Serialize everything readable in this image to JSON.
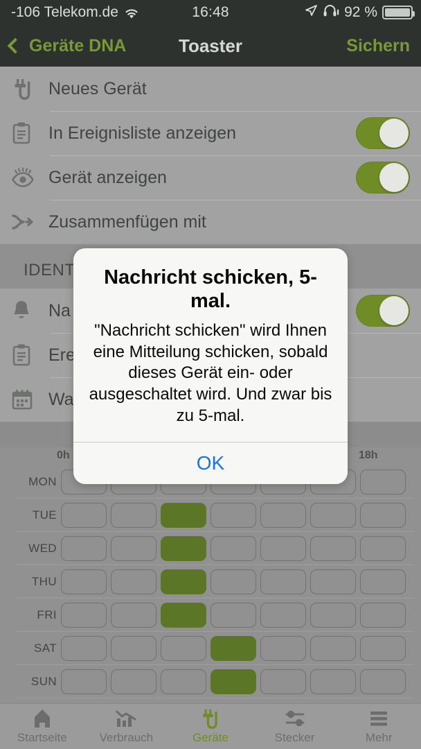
{
  "status_bar": {
    "carrier": "-106 Telekom.de",
    "wifi_icon": "wifi-icon",
    "time": "16:48",
    "location_icon": "location-arrow-icon",
    "headphones_icon": "headphones-icon",
    "battery_percent": "92 %",
    "battery_icon": "battery-icon"
  },
  "nav_bar": {
    "back_label": "Geräte DNA",
    "back_icon": "chevron-left-icon",
    "title": "Toaster",
    "save_label": "Sichern"
  },
  "settings_top": {
    "rows": [
      {
        "icon": "plug-icon",
        "label": "Neues Gerät",
        "toggle": null
      },
      {
        "icon": "clipboard-icon",
        "label": "In Ereignisliste anzeigen",
        "toggle": "on"
      },
      {
        "icon": "eye-icon",
        "label": "Gerät anzeigen",
        "toggle": "on"
      },
      {
        "icon": "merge-arrow-icon",
        "label": "Zusammenfügen mit",
        "toggle": null
      }
    ]
  },
  "section": {
    "header": "IDENTIFIKATION"
  },
  "settings_lower": {
    "rows": [
      {
        "icon": "bell-icon",
        "label": "Na",
        "toggle": "on"
      },
      {
        "icon": "clipboard-icon",
        "label": "Ere",
        "toggle": null
      },
      {
        "icon": "calendar-icon",
        "label": "Wa",
        "toggle": null
      }
    ]
  },
  "schedule": {
    "hour_labels": {
      "start": "0h",
      "end": "18h"
    },
    "days": [
      "MON",
      "TUE",
      "WED",
      "THU",
      "FRI",
      "SAT",
      "SUN"
    ],
    "columns": 7,
    "active_cells": {
      "MON": [],
      "TUE": [
        2
      ],
      "WED": [
        2
      ],
      "THU": [
        2
      ],
      "FRI": [
        2
      ],
      "SAT": [
        3
      ],
      "SUN": [
        3
      ]
    }
  },
  "tab_bar": {
    "tabs": [
      {
        "label": "Startseite",
        "icon": "home-icon",
        "active": false
      },
      {
        "label": "Verbrauch",
        "icon": "chart-icon",
        "active": false
      },
      {
        "label": "Geräte",
        "icon": "plug-icon",
        "active": true
      },
      {
        "label": "Stecker",
        "icon": "slider-icon",
        "active": false
      },
      {
        "label": "Mehr",
        "icon": "menu-icon",
        "active": false
      }
    ]
  },
  "alert": {
    "title": "Nachricht schicken, 5-mal.",
    "message": "\"Nachricht schicken\" wird Ihnen eine Mitteilung schicken, sobald dieses Gerät ein- oder ausgeschaltet wird. Und zwar bis zu 5-mal.",
    "ok_label": "OK"
  },
  "colors": {
    "nav_background": "#252b26",
    "accent_green": "#7b9c2e",
    "toggle_green": "#6f8f1e",
    "cell_green": "#59761f",
    "list_background": "#a8a8a8",
    "page_background": "#8f8f8f",
    "alert_button_blue": "#1474ec"
  }
}
